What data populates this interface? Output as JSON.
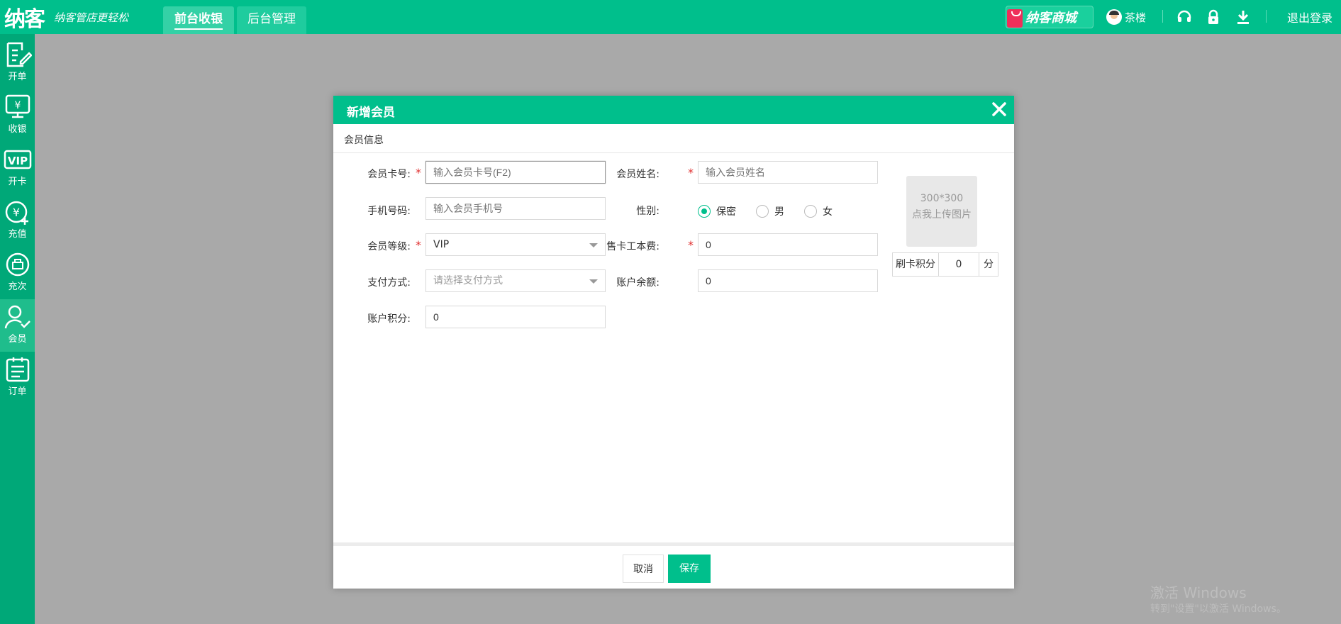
{
  "header": {
    "logo": "纳客",
    "slogan": "纳客管店更轻松",
    "tabs": [
      {
        "label": "前台收银",
        "active": true
      },
      {
        "label": "后台管理",
        "active": false
      }
    ],
    "mall_label": "纳客商城",
    "user_name": "茶楼",
    "logout_label": "退出登录",
    "icons": [
      "headset-icon",
      "lock-icon",
      "download-icon"
    ]
  },
  "sidebar": {
    "items": [
      {
        "label": "开单",
        "icon": "order-edit-icon"
      },
      {
        "label": "收银",
        "icon": "cashier-icon"
      },
      {
        "label": "开卡",
        "icon": "vip-card-icon"
      },
      {
        "label": "充值",
        "icon": "recharge-icon"
      },
      {
        "label": "充次",
        "icon": "recharge-times-icon"
      },
      {
        "label": "会员",
        "icon": "member-icon",
        "active": true
      },
      {
        "label": "订单",
        "icon": "order-list-icon"
      }
    ]
  },
  "modal": {
    "title": "新增会员",
    "section": "会员信息",
    "fields": {
      "card_no": {
        "label": "会员卡号:",
        "placeholder": "输入会员卡号(F2)",
        "value": ""
      },
      "name": {
        "label": "会员姓名:",
        "placeholder": "输入会员姓名",
        "value": ""
      },
      "phone": {
        "label": "手机号码:",
        "placeholder": "输入会员手机号",
        "value": ""
      },
      "gender": {
        "label": "性别:",
        "options": [
          "保密",
          "男",
          "女"
        ],
        "selected": "保密"
      },
      "level": {
        "label": "会员等级:",
        "value": "VIP"
      },
      "card_fee": {
        "label": "售卡工本费:",
        "value": "0"
      },
      "payment": {
        "label": "支付方式:",
        "placeholder": "请选择支付方式",
        "value": ""
      },
      "balance": {
        "label": "账户余额:",
        "value": "0"
      },
      "points": {
        "label": "账户积分:",
        "value": "0"
      }
    },
    "upload": {
      "size": "300*300",
      "hint": "点我上传图片"
    },
    "swipe_points": {
      "label": "刷卡积分",
      "value": "0",
      "unit": "分"
    },
    "buttons": {
      "cancel": "取消",
      "save": "保存"
    }
  },
  "watermark": {
    "line1": "激活 Windows",
    "line2": "转到\"设置\"以激活 Windows。"
  },
  "colors": {
    "brand": "#00bf8c",
    "sidebar": "#00a878",
    "required": "#e03030"
  }
}
